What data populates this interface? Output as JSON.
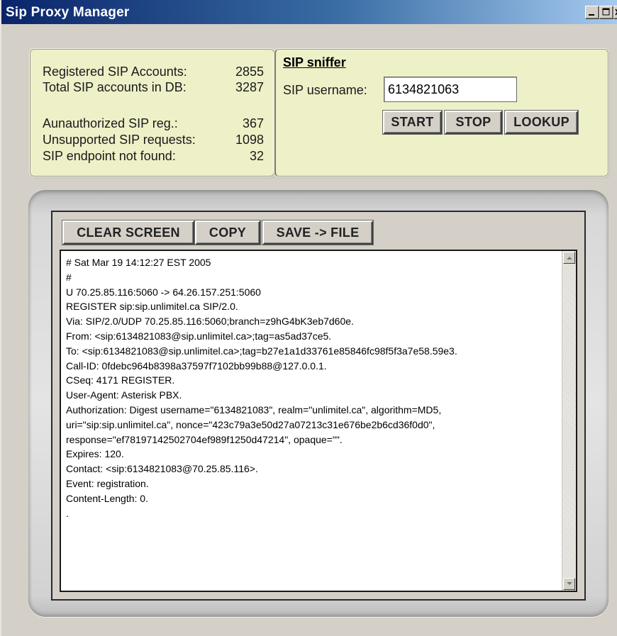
{
  "window": {
    "title": "Sip Proxy Manager"
  },
  "stats": [
    {
      "label": "Registered SIP Accounts:",
      "value": "2855"
    },
    {
      "label": "Total SIP accounts in DB:",
      "value": "3287"
    },
    {
      "label": "Aunauthorized SIP reg.:",
      "value": "367"
    },
    {
      "label": "Unsupported SIP requests:",
      "value": "1098"
    },
    {
      "label": "SIP endpoint not found:",
      "value": "32"
    }
  ],
  "sniffer": {
    "title": "SIP sniffer",
    "username_label": "SIP username:",
    "username_value": "6134821063",
    "start_label": "START",
    "stop_label": "STOP",
    "lookup_label": "LOOKUP"
  },
  "console": {
    "clear_label": "CLEAR SCREEN",
    "copy_label": "COPY",
    "save_label": "SAVE -> FILE",
    "log_lines": [
      "# Sat Mar 19 14:12:27 EST 2005",
      "#",
      "U 70.25.85.116:5060 -> 64.26.157.251:5060",
      "REGISTER sip:sip.unlimitel.ca SIP/2.0.",
      "Via: SIP/2.0/UDP 70.25.85.116:5060;branch=z9hG4bK3eb7d60e.",
      "From: <sip:6134821083@sip.unlimitel.ca>;tag=as5ad37ce5.",
      "To: <sip:6134821083@sip.unlimitel.ca>;tag=b27e1a1d33761e85846fc98f5f3a7e58.59e3.",
      "Call-ID: 0fdebc964b8398a37597f7102bb99b88@127.0.0.1.",
      "CSeq: 4171 REGISTER.",
      "User-Agent: Asterisk PBX.",
      "Authorization: Digest username=\"6134821083\", realm=\"unlimitel.ca\", algorithm=MD5,",
      "uri=\"sip:sip.unlimitel.ca\", nonce=\"423c79a3e50d27a07213c31e676be2b6cd36f0d0\",",
      "response=\"ef78197142502704ef989f1250d47214\", opaque=\"\".",
      "Expires: 120.",
      "Contact: <sip:6134821083@70.25.85.116>.",
      "Event: registration.",
      "Content-Length: 0.",
      "."
    ]
  }
}
